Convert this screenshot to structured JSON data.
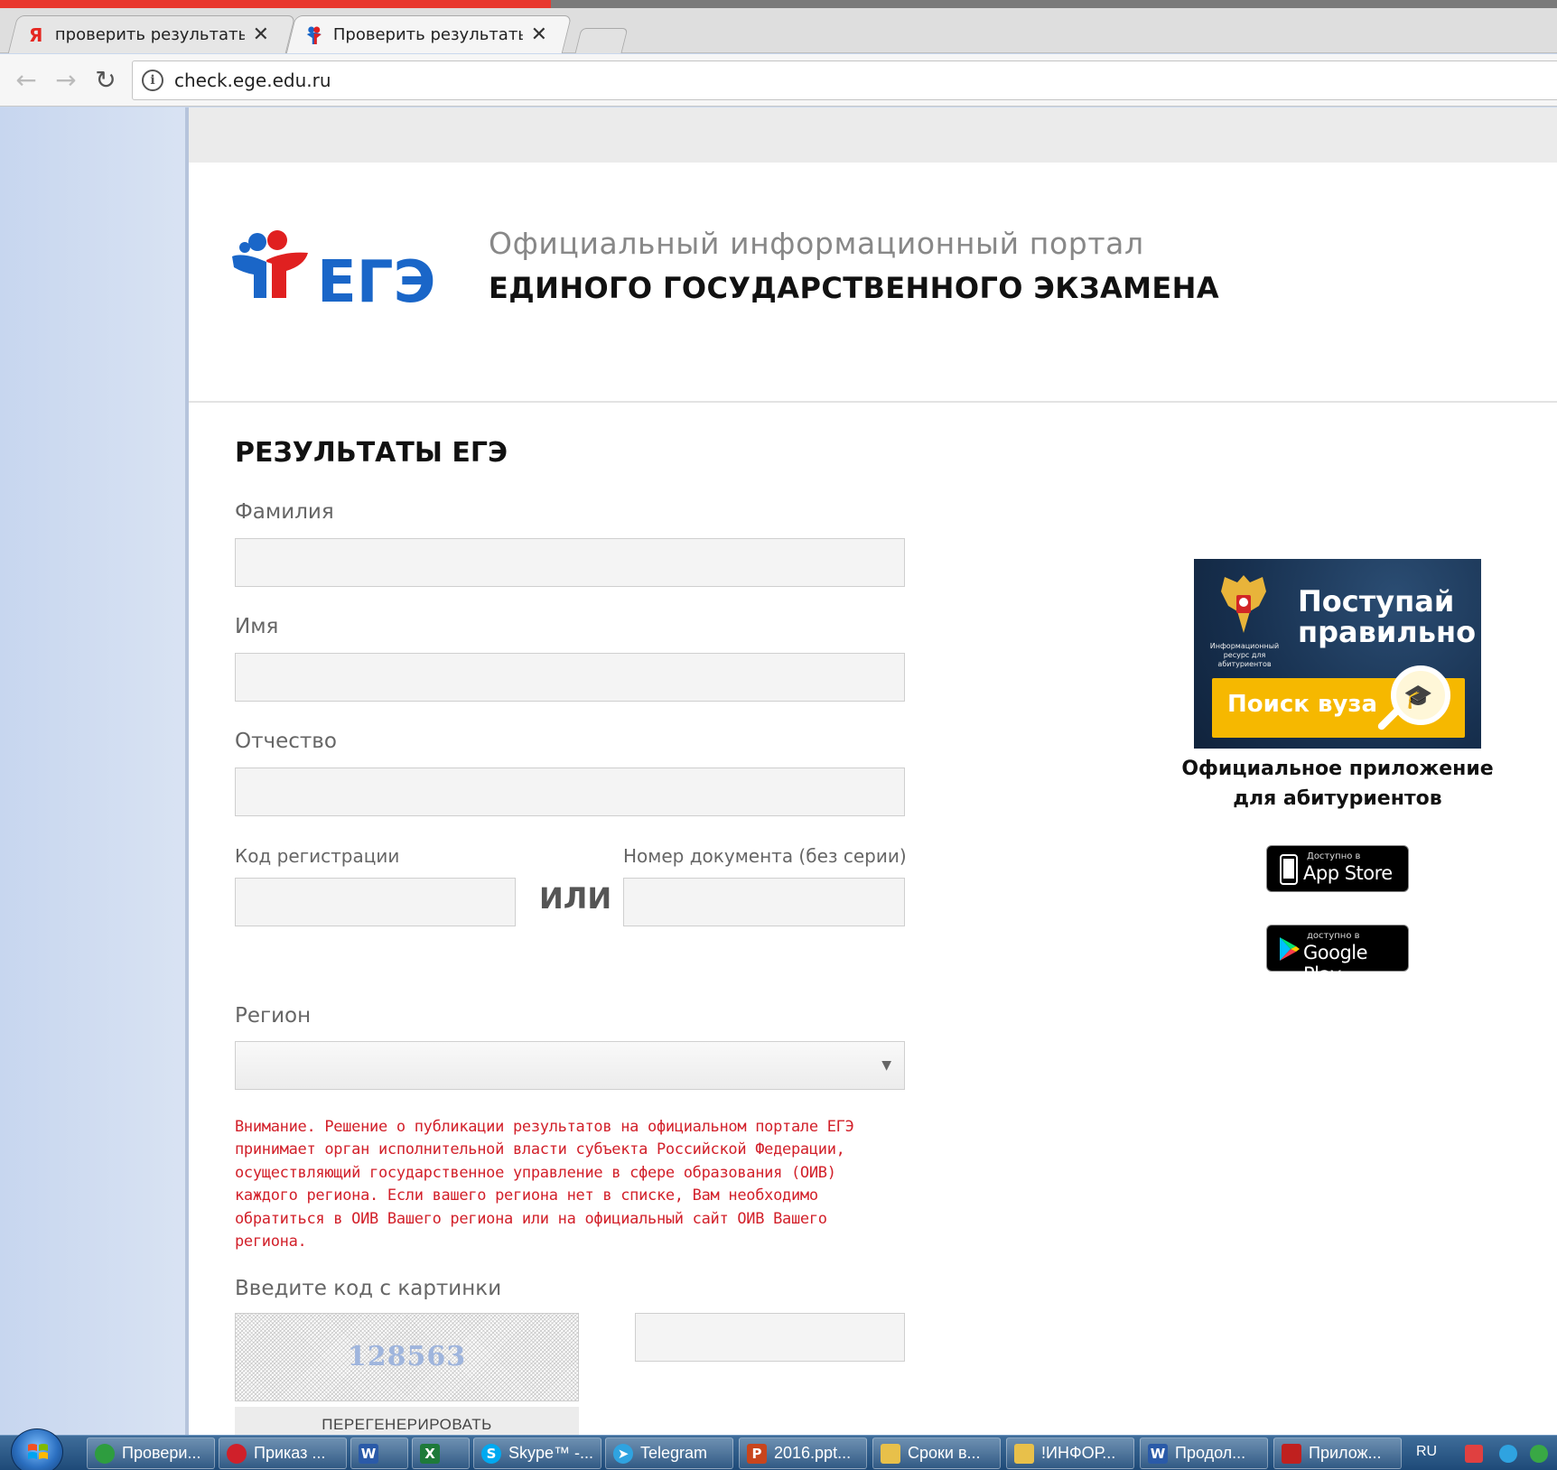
{
  "browser": {
    "tabs": [
      {
        "title": "проверить результаты е",
        "favicon": "Я"
      },
      {
        "title": "Проверить результаты Е",
        "favicon": "ege-logo"
      }
    ],
    "url": "check.ege.edu.ru"
  },
  "header": {
    "logo_text": "ЕГЭ",
    "portal_subtitle": "Официальный информационный портал",
    "portal_title": "ЕДИНОГО ГОСУДАРСТВЕННОГО ЭКЗАМЕНА"
  },
  "form": {
    "title": "РЕЗУЛЬТАТЫ ЕГЭ",
    "surname_label": "Фамилия",
    "name_label": "Имя",
    "patronymic_label": "Отчество",
    "reg_code_label": "Код регистрации",
    "or_label": "ИЛИ",
    "doc_number_label": "Номер документа (без серии)",
    "region_label": "Регион",
    "region_value": "",
    "warning": "Внимание. Решение о публикации результатов на официальном портале ЕГЭ принимает орган исполнительной власти субъекта Российской Федерации, осуществляющий государственное управление в сфере образования (ОИВ) каждого региона. Если вашего региона нет в списке, Вам необходимо обратиться в ОИВ Вашего региона или на официальный сайт ОИВ Вашего региона.",
    "captcha_label": "Введите код с картинки",
    "captcha_code": "128563",
    "regen_button": "ПЕРЕГЕНЕРИРОВАТЬ"
  },
  "promo": {
    "headline": "Поступай правильно",
    "search_button": "Поиск вуза",
    "emblem_caption": "Информационный ресурс для абитуриентов",
    "caption": "Официальное приложение для абитуриентов",
    "appstore_small": "Доступно в",
    "appstore_big": "App Store",
    "googleplay_small": "доступно в",
    "googleplay_big": "Google Play"
  },
  "taskbar": {
    "items": [
      {
        "label": "Провери...",
        "icon": "chrome-icon",
        "color": "#2e9d3f"
      },
      {
        "label": "Приказ ...",
        "icon": "opera-icon",
        "color": "#d0202a"
      },
      {
        "label": "",
        "icon": "word-icon",
        "color": "#2a5aa8"
      },
      {
        "label": "",
        "icon": "excel-icon",
        "color": "#1e7a3a"
      },
      {
        "label": "Skype™ -...",
        "icon": "skype-icon",
        "color": "#00a9f0"
      },
      {
        "label": "Telegram",
        "icon": "telegram-icon",
        "color": "#2fa3e0"
      },
      {
        "label": "2016.ppt...",
        "icon": "powerpoint-icon",
        "color": "#c8451d"
      },
      {
        "label": "Сроки в...",
        "icon": "folder-icon",
        "color": "#e8c04a"
      },
      {
        "label": "!ИНФОР...",
        "icon": "folder-icon",
        "color": "#e8c04a"
      },
      {
        "label": "Продол...",
        "icon": "word-icon",
        "color": "#2a5aa8"
      },
      {
        "label": "Прилож...",
        "icon": "pdf-icon",
        "color": "#c0201f"
      }
    ],
    "language": "RU"
  },
  "colors": {
    "warning": "#d2202a",
    "logo_blue": "#1a66c8",
    "logo_red": "#e02020",
    "promo_yellow": "#f6b800"
  }
}
